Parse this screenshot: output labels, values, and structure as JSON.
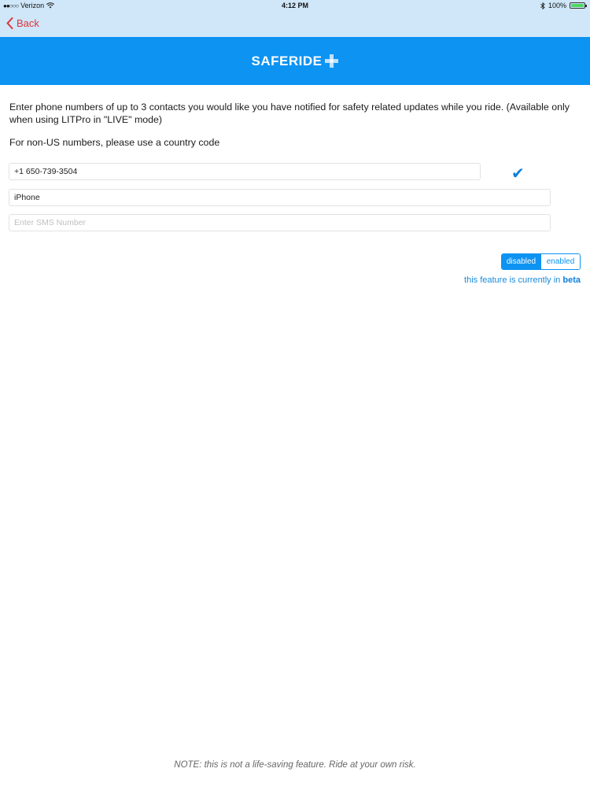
{
  "status_bar": {
    "carrier": "Verizon",
    "time": "4:12 PM",
    "battery": "100%"
  },
  "nav": {
    "back_label": "Back"
  },
  "header": {
    "title": "SAFERIDE"
  },
  "content": {
    "intro": "Enter phone numbers of up to 3 contacts you would like you have notified for safety related updates while you ride. (Available only when using LITPro in \"LIVE\" mode)",
    "country_note": "For non-US numbers, please use a country code"
  },
  "fields": {
    "phone_value": "+1 650-739-3504",
    "iphone_value": "iPhone",
    "sms_placeholder": "Enter SMS Number"
  },
  "toggle": {
    "disabled_label": "disabled",
    "enabled_label": "enabled",
    "selected": "disabled"
  },
  "beta": {
    "prefix": "this feature is currently in ",
    "word": "beta"
  },
  "footer": {
    "note": "NOTE: this is not a life-saving feature.  Ride at your own risk."
  },
  "colors": {
    "accent": "#0d93f2",
    "back": "#e0323a",
    "nav_bg": "#cfe7f8"
  },
  "icons": [
    "wifi-icon",
    "bluetooth-icon",
    "battery-icon",
    "chevron-left-icon",
    "plus-cross-icon",
    "checkmark-icon"
  ]
}
